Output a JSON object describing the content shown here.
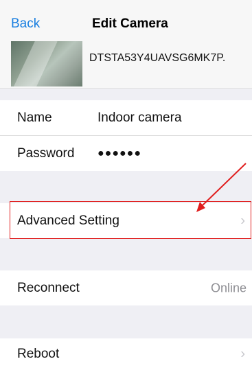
{
  "nav": {
    "back_label": "Back",
    "title": "Edit Camera"
  },
  "camera": {
    "id": "DTSTA53Y4UAVSG6MK7P."
  },
  "fields": {
    "name_label": "Name",
    "name_value": "Indoor camera",
    "password_label": "Password",
    "password_value": "●●●●●●"
  },
  "advanced": {
    "label": "Advanced Setting",
    "chevron": "›"
  },
  "reconnect": {
    "label": "Reconnect",
    "status": "Online"
  },
  "reboot": {
    "label": "Reboot",
    "chevron": "›"
  },
  "annotation": {
    "arrow_color": "#e01e1e",
    "box_color": "#e01e1e"
  }
}
